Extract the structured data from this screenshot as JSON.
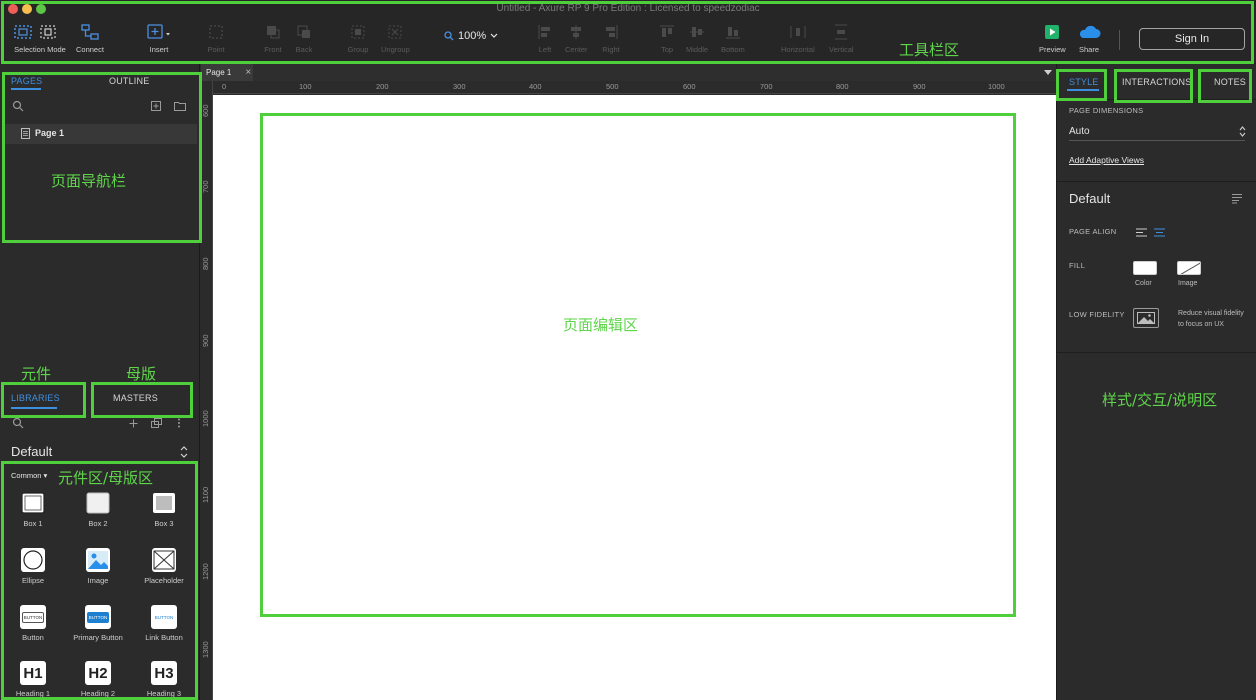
{
  "window": {
    "title": "Untitled - Axure RP 9 Pro Edition : Licensed to speedzodiac"
  },
  "toolbar": {
    "selection_mode": "Selection Mode",
    "connect": "Connect",
    "insert": "Insert",
    "point": "Point",
    "front": "Front",
    "back": "Back",
    "group": "Group",
    "ungroup": "Ungroup",
    "zoom": "100%",
    "left": "Left",
    "center": "Center",
    "right": "Right",
    "top": "Top",
    "middle": "Middle",
    "bottom": "Bottom",
    "horizontal": "Horizontal",
    "vertical": "Vertical",
    "preview": "Preview",
    "share": "Share",
    "sign_in": "Sign In"
  },
  "left_panel": {
    "tabs": {
      "pages": "PAGES",
      "outline": "OUTLINE"
    },
    "pages": [
      {
        "label": "Page 1"
      }
    ],
    "lib_tabs": {
      "libraries": "LIBRARIES",
      "masters": "MASTERS"
    },
    "library_name": "Default",
    "category": "Common",
    "items": [
      {
        "label": "Box 1"
      },
      {
        "label": "Box 2"
      },
      {
        "label": "Box 3"
      },
      {
        "label": "Ellipse"
      },
      {
        "label": "Image"
      },
      {
        "label": "Placeholder"
      },
      {
        "label": "Button"
      },
      {
        "label": "Primary Button"
      },
      {
        "label": "Link Button"
      },
      {
        "label": "Heading 1"
      },
      {
        "label": "Heading 2"
      },
      {
        "label": "Heading 3"
      }
    ],
    "button_text": "BUTTON",
    "h_labels": [
      "H1",
      "H2",
      "H3"
    ]
  },
  "canvas": {
    "page_tab": "Page 1",
    "close": "×",
    "h_ruler": [
      "0",
      "100",
      "200",
      "300",
      "400",
      "500",
      "600",
      "700",
      "800",
      "900",
      "1000"
    ],
    "v_ruler": [
      "600",
      "700",
      "800",
      "900",
      "1000",
      "1100",
      "1200",
      "1300"
    ]
  },
  "right_panel": {
    "tabs": {
      "style": "STYLE",
      "interactions": "INTERACTIONS",
      "notes": "NOTES"
    },
    "page_dimensions_label": "PAGE DIMENSIONS",
    "page_dimensions_value": "Auto",
    "add_adaptive_views": "Add Adaptive Views",
    "style_name": "Default",
    "page_align_label": "PAGE ALIGN",
    "fill_label": "FILL",
    "fill_color": "Color",
    "fill_image": "Image",
    "low_fidelity_label": "LOW FIDELITY",
    "low_fidelity_desc_1": "Reduce visual fidelity",
    "low_fidelity_desc_2": "to focus on UX"
  },
  "annotations": {
    "toolbar": "工具栏区",
    "pages_nav": "页面导航栏",
    "components": "元件",
    "masters": "母版",
    "lib_area": "元件区/母版区",
    "canvas": "页面编辑区",
    "inspector": "样式/交互/说明区"
  },
  "colors": {
    "highlight": "#4fcf3c",
    "accent": "#3f8fe0",
    "annotation_text": "#5fd64a"
  }
}
